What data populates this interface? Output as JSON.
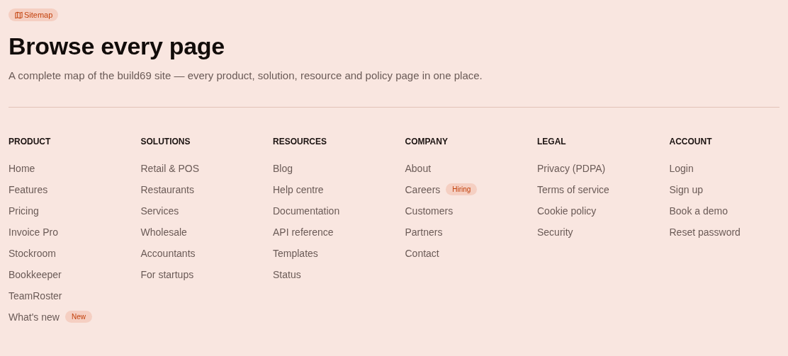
{
  "badge": {
    "label": "Sitemap"
  },
  "title": "Browse every page",
  "description": "A complete map of the build69 site — every product, solution, resource and policy page in one place.",
  "columns": [
    {
      "heading": "PRODUCT",
      "links": [
        {
          "label": "Home"
        },
        {
          "label": "Features"
        },
        {
          "label": "Pricing"
        },
        {
          "label": "Invoice Pro"
        },
        {
          "label": "Stockroom"
        },
        {
          "label": "Bookkeeper"
        },
        {
          "label": "TeamRoster"
        },
        {
          "label": "What's new",
          "tag": "New"
        }
      ]
    },
    {
      "heading": "SOLUTIONS",
      "links": [
        {
          "label": "Retail & POS"
        },
        {
          "label": "Restaurants"
        },
        {
          "label": "Services"
        },
        {
          "label": "Wholesale"
        },
        {
          "label": "Accountants"
        },
        {
          "label": "For startups"
        }
      ]
    },
    {
      "heading": "RESOURCES",
      "links": [
        {
          "label": "Blog"
        },
        {
          "label": "Help centre"
        },
        {
          "label": "Documentation"
        },
        {
          "label": "API reference"
        },
        {
          "label": "Templates"
        },
        {
          "label": "Status"
        }
      ]
    },
    {
      "heading": "COMPANY",
      "links": [
        {
          "label": "About"
        },
        {
          "label": "Careers",
          "tag": "Hiring"
        },
        {
          "label": "Customers"
        },
        {
          "label": "Partners"
        },
        {
          "label": "Contact"
        }
      ]
    },
    {
      "heading": "LEGAL",
      "links": [
        {
          "label": "Privacy (PDPA)"
        },
        {
          "label": "Terms of service"
        },
        {
          "label": "Cookie policy"
        },
        {
          "label": "Security"
        }
      ]
    },
    {
      "heading": "ACCOUNT",
      "links": [
        {
          "label": "Login"
        },
        {
          "label": "Sign up"
        },
        {
          "label": "Book a demo"
        },
        {
          "label": "Reset password"
        }
      ]
    }
  ]
}
